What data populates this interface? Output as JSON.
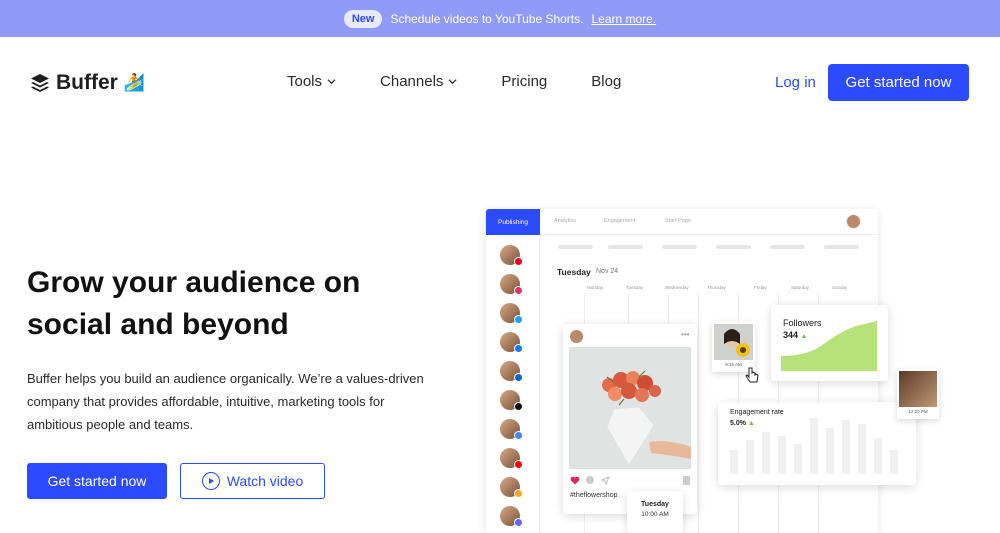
{
  "announcement": {
    "badge": "New",
    "text": "Schedule videos to YouTube Shorts.",
    "link": "Learn more."
  },
  "nav": {
    "brand": "Buffer",
    "links": [
      "Tools",
      "Channels",
      "Pricing",
      "Blog"
    ],
    "login": "Log in",
    "cta": "Get started now"
  },
  "hero": {
    "headline": "Grow your audience on social and beyond",
    "subtext": "Buffer helps you build an audience organically. We’re a values-driven company that provides affordable, intuitive, marketing tools for ambitious people and teams.",
    "primary_cta": "Get started now",
    "video_cta": "Watch video"
  },
  "app": {
    "tabs": [
      "Publishing",
      "Analytics",
      "Engagement",
      "Start Page"
    ],
    "day": "Tuesday",
    "date": "Nov 24",
    "weekdays": [
      "Monday",
      "Tuesday",
      "Wednesday",
      "Thursday",
      "Friday",
      "Saturday",
      "Sunday"
    ],
    "post_tag": "#theflowershop",
    "scheduled_day": "Tuesday",
    "scheduled_time": "10:00 AM",
    "thumb1_time": "9:15 AM",
    "thumb2_time": "12:20 PM",
    "followers_label": "Followers",
    "followers_value": "344",
    "engagement_label": "Engagement rate",
    "engagement_value": "5.0%"
  },
  "colors": {
    "brand_blue": "#2c4bff",
    "announce_bg": "#8f9bf6",
    "growth_green": "#b7e27a"
  }
}
